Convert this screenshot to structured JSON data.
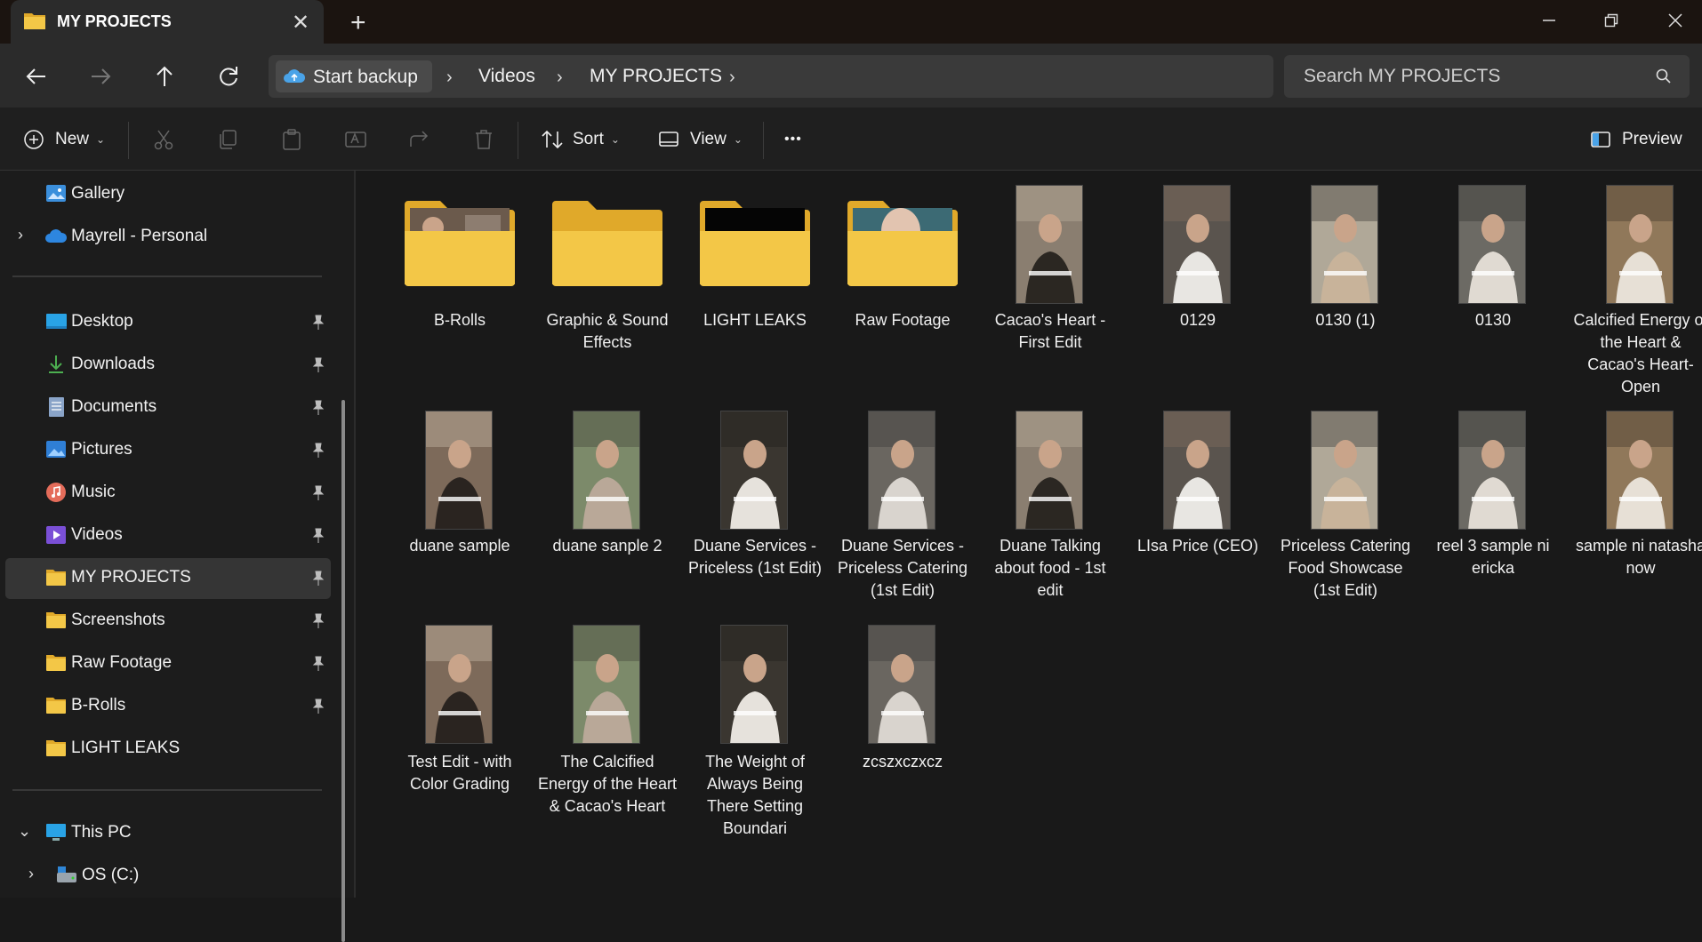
{
  "window": {
    "tab_title": "MY PROJECTS",
    "new_tab_symbol": "+",
    "close_tab_symbol": "✕"
  },
  "address": {
    "backup_label": "Start backup",
    "crumbs": [
      "Videos",
      "MY PROJECTS"
    ],
    "search_placeholder": "Search MY PROJECTS"
  },
  "commands": {
    "new_label": "New",
    "sort_label": "Sort",
    "view_label": "View",
    "more_label": "•••",
    "preview_label": "Preview"
  },
  "sidebar": {
    "top": [
      {
        "label": "Gallery",
        "icon": "gallery-icon"
      },
      {
        "label": "Mayrell - Personal",
        "icon": "onedrive-cloud-icon"
      }
    ],
    "quick": [
      {
        "label": "Desktop",
        "icon": "desktop-icon"
      },
      {
        "label": "Downloads",
        "icon": "download-icon"
      },
      {
        "label": "Documents",
        "icon": "documents-icon"
      },
      {
        "label": "Pictures",
        "icon": "pictures-icon"
      },
      {
        "label": "Music",
        "icon": "music-icon"
      },
      {
        "label": "Videos",
        "icon": "videos-icon"
      },
      {
        "label": "MY PROJECTS",
        "icon": "folder-icon",
        "selected": true
      },
      {
        "label": "Screenshots",
        "icon": "folder-icon"
      },
      {
        "label": "Raw Footage",
        "icon": "folder-icon"
      },
      {
        "label": "B-Rolls",
        "icon": "folder-icon"
      },
      {
        "label": "LIGHT LEAKS",
        "icon": "folder-icon"
      }
    ],
    "bottom": [
      {
        "label": "This PC",
        "icon": "this-pc-icon"
      },
      {
        "label": "OS (C:)",
        "icon": "drive-icon"
      }
    ]
  },
  "files": [
    {
      "name": "B-Rolls",
      "kind": "folder"
    },
    {
      "name": "Graphic & Sound Effects",
      "kind": "folder"
    },
    {
      "name": "LIGHT LEAKS",
      "kind": "folder"
    },
    {
      "name": "Raw Footage",
      "kind": "folder"
    },
    {
      "name": "Cacao's Heart - First Edit",
      "kind": "video"
    },
    {
      "name": "0129",
      "kind": "video"
    },
    {
      "name": "0130 (1)",
      "kind": "video"
    },
    {
      "name": "0130",
      "kind": "video"
    },
    {
      "name": "Calcified Energy of the Heart & Cacao's Heart-Open",
      "kind": "video"
    },
    {
      "name": "duane sample",
      "kind": "video"
    },
    {
      "name": "duane sanple 2",
      "kind": "video"
    },
    {
      "name": "Duane Services - Priceless (1st Edit)",
      "kind": "video"
    },
    {
      "name": "Duane Services - Priceless Catering (1st Edit)",
      "kind": "video"
    },
    {
      "name": "Duane Talking about food - 1st edit",
      "kind": "video"
    },
    {
      "name": "LIsa Price (CEO)",
      "kind": "video"
    },
    {
      "name": "Priceless Catering Food Showcase (1st Edit)",
      "kind": "video"
    },
    {
      "name": "reel 3 sample ni ericka",
      "kind": "video"
    },
    {
      "name": "sample ni natasha now",
      "kind": "video"
    },
    {
      "name": "Test Edit - with Color Grading",
      "kind": "video"
    },
    {
      "name": "The Calcified Energy of the Heart & Cacao's Heart",
      "kind": "video"
    },
    {
      "name": "The Weight of Always Being There Setting Boundari",
      "kind": "video"
    },
    {
      "name": "zcszxczxcz",
      "kind": "video"
    }
  ],
  "colors": {
    "folder_yellow": "#f3c747",
    "folder_back": "#e0a92a",
    "accent_blue": "#4aa3e8"
  }
}
